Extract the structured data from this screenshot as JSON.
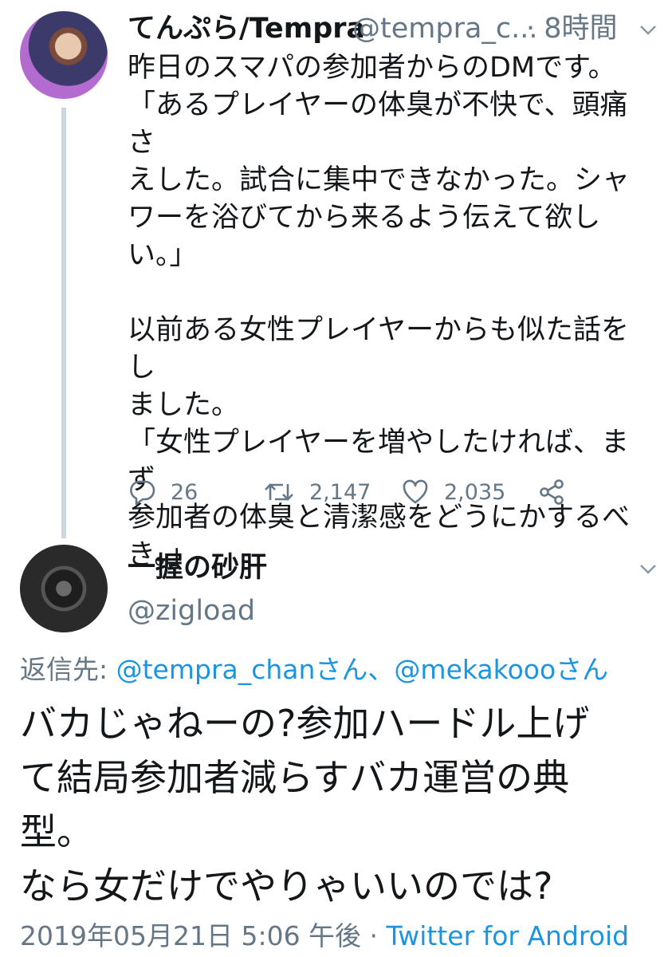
{
  "tweet": {
    "author_name": "てんぷら/Tempra",
    "author_handle": "@tempra_c...",
    "time": "· 8時間",
    "body": "昨日のスマパの参加者からのDMです。\n「あるプレイヤーの体臭が不快で、頭痛さ\nえした。試合に集中できなかった。シャ\nワーを浴びてから来るよう伝えて欲し\nい。」\n\n以前ある女性プレイヤーからも似た話をし\nました。\n「女性プレイヤーを増やしたければ、まず\n参加者の体臭と清潔感をどうにかするべ\nき。」",
    "replies": "26",
    "retweets": "2,147",
    "likes": "2,035"
  },
  "reply": {
    "author_name": "一握の砂肝",
    "author_handle": "@zigload",
    "reply_to_prefix": "返信先: ",
    "reply_to_mentions": "@tempra_chanさん、@mekakoooさん",
    "body": "バカじゃねーの?参加ハードル上げ\nて結局参加者減らすバカ運営の典\n型。\nなら女だけでやりゃいいのでは?",
    "timestamp": "2019年05月21日 5:06 午後 · ",
    "source": "Twitter for Android"
  },
  "colors": {
    "text": "#14171a",
    "secondary": "#657786",
    "link": "#1b95e0",
    "thread_line": "#ccd6dd"
  },
  "icons": [
    "chevron-down-icon",
    "reply-icon",
    "retweet-icon",
    "like-icon",
    "share-icon"
  ]
}
